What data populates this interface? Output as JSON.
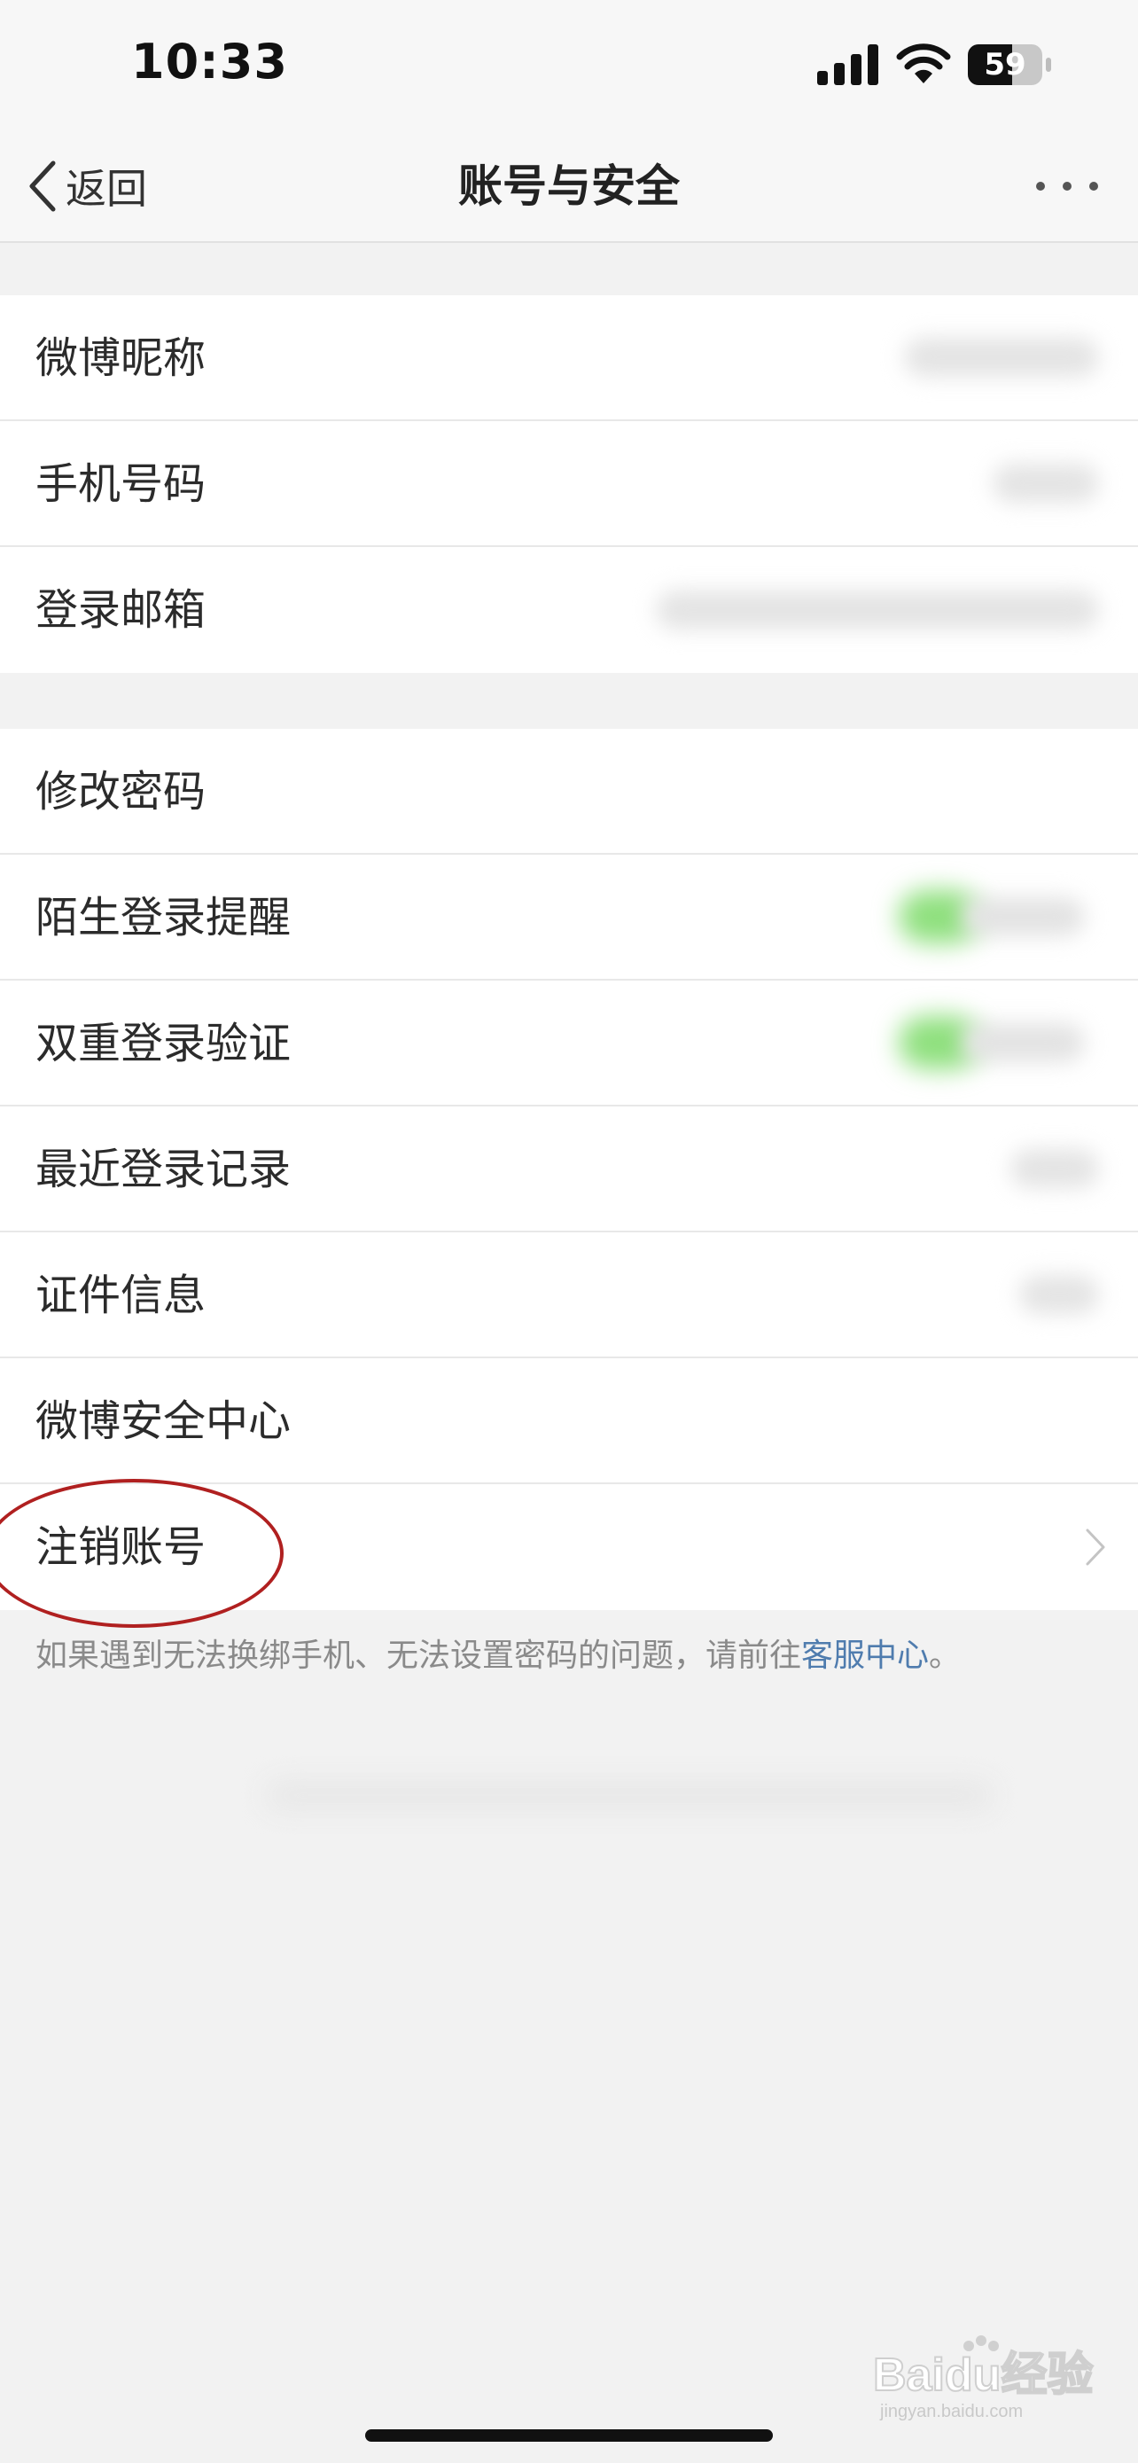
{
  "status_bar": {
    "time": "10:33",
    "battery": "59"
  },
  "nav": {
    "back_label": "返回",
    "title": "账号与安全"
  },
  "groups": [
    {
      "items": [
        {
          "label": "微博昵称"
        },
        {
          "label": "手机号码"
        },
        {
          "label": "登录邮箱"
        }
      ]
    },
    {
      "items": [
        {
          "label": "修改密码"
        },
        {
          "label": "陌生登录提醒"
        },
        {
          "label": "双重登录验证"
        },
        {
          "label": "最近登录记录"
        },
        {
          "label": "证件信息"
        },
        {
          "label": "微博安全中心"
        },
        {
          "label": "注销账号"
        }
      ]
    }
  ],
  "footer": {
    "note_prefix": "如果遇到无法换绑手机、无法设置密码的问题，请前往",
    "link": "客服中心",
    "note_suffix": "。"
  },
  "watermark": {
    "text": "Baidu经验",
    "subtext": "jingyan.baidu.com"
  },
  "colors": {
    "background": "#f2f2f2",
    "card": "#ffffff",
    "link": "#4f7cae",
    "annotation_circle": "#b02020",
    "toggle_on": "#8fe07e"
  },
  "icons": {
    "back": "chevron-left-icon",
    "more": "more-dots-icon",
    "row_arrow": "chevron-right-icon"
  }
}
